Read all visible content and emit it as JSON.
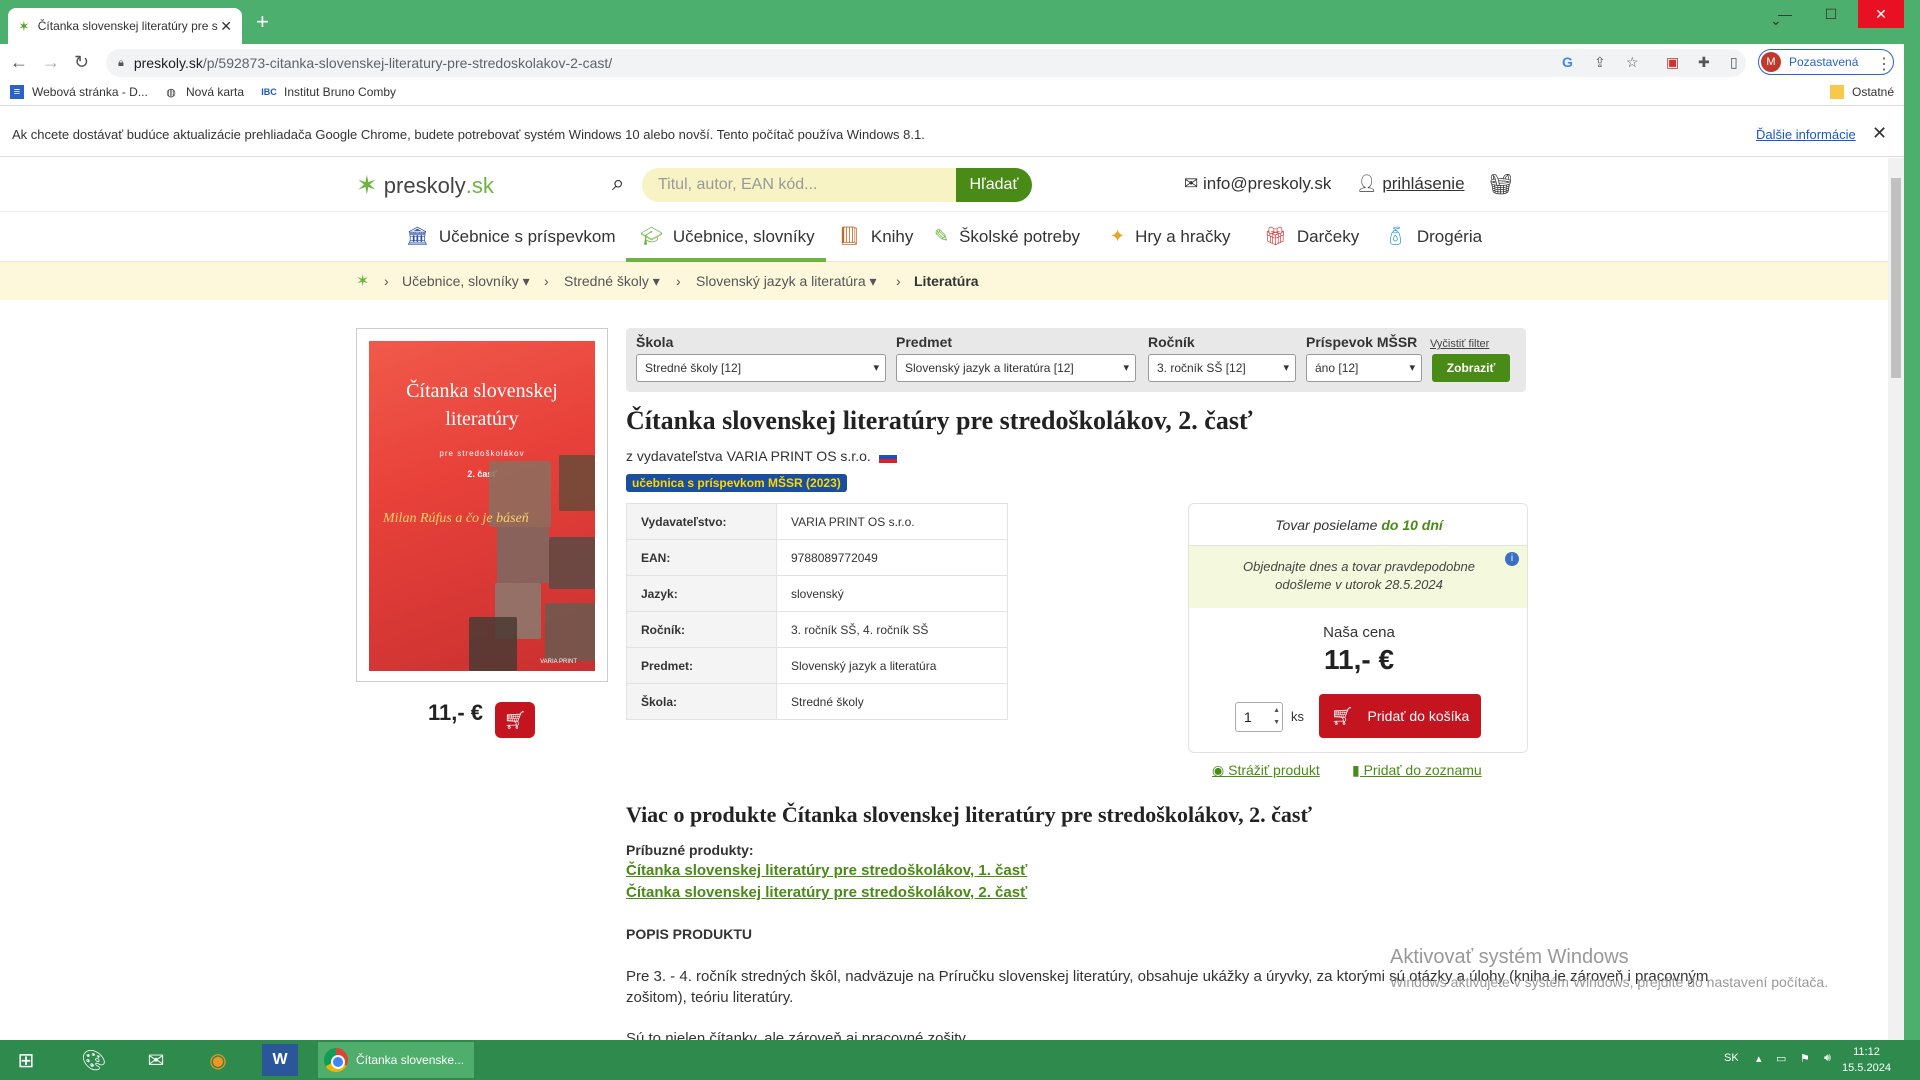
{
  "browser": {
    "tab_title": "Čítanka slovenskej literatúry pre s",
    "url_host": "preskoly.sk",
    "url_path": "/p/592873-citanka-slovenskej-literatury-pre-stredoskolakov-2-cast/",
    "profile_initial": "M",
    "profile_label": "Pozastavená",
    "bookmarks": [
      "Webová stránka - D...",
      "Nová karta",
      "Institut Bruno Comby"
    ],
    "bookmarks_other": "Ostatné",
    "infobar_text": "Ak chcete dostávať budúce aktualizácie prehliadača Google Chrome, budete potrebovať systém Windows 10 alebo novší. Tento počítač používa Windows 8.1.",
    "infobar_link": "Ďalšie informácie"
  },
  "site": {
    "logo_main": "preskoly",
    "logo_tld": ".sk",
    "search_placeholder": "Titul, autor, EAN kód...",
    "search_button": "Hľadať",
    "email": "info@preskoly.sk",
    "login": "prihlásenie",
    "nav": [
      "Učebnice s príspevkom",
      "Učebnice, slovníky",
      "Knihy",
      "Školské potreby",
      "Hry a hračky",
      "Darčeky",
      "Drogéria"
    ],
    "breadcrumbs": [
      "Učebnice, slovníky",
      "Stredné školy",
      "Slovenský jazyk a literatúra",
      "Literatúra"
    ]
  },
  "filter": {
    "labels": [
      "Škola",
      "Predmet",
      "Ročník",
      "Príspevok MŠSR"
    ],
    "values": [
      "Stredné školy [12]",
      "Slovenský jazyk a literatúra [12]",
      "3. ročník SŠ [12]",
      "áno [12]"
    ],
    "clear": "Vyčistiť filter",
    "show": "Zobraziť"
  },
  "product": {
    "title": "Čítanka slovenskej literatúry pre stredoškolákov, 2. časť",
    "publisher_line": "z vydavateľstva VARIA PRINT OS s.r.o.",
    "badge": "učebnica s príspevkom MŠSR (2023)",
    "cover": {
      "title": "Čítanka slovenskej literatúry",
      "subtitle": "pre stredoškolákov",
      "part": "2. časť",
      "signature": "Milan Rúfus a čo je báseň",
      "publisher": "VARIA PRINT"
    },
    "price_small": "11,- €",
    "details": [
      {
        "k": "Vydavateľstvo:",
        "v": "VARIA PRINT OS s.r.o."
      },
      {
        "k": "EAN:",
        "v": "9788089772049"
      },
      {
        "k": "Jazyk:",
        "v": "slovenský"
      },
      {
        "k": "Ročník:",
        "v": "3. ročník SŠ, 4. ročník SŠ"
      },
      {
        "k": "Predmet:",
        "v": "Slovenský jazyk a literatúra"
      },
      {
        "k": "Škola:",
        "v": "Stredné školy"
      }
    ],
    "shipping_pre": "Tovar posielame",
    "shipping_bold": "do 10 dní",
    "order_line1": "Objednajte dnes a tovar pravdepodobne",
    "order_line2": "odošleme v utorok 28.5.2024",
    "our_price_label": "Naša cena",
    "price": "11,- €",
    "qty": "1",
    "qty_unit": "ks",
    "add_to_cart": "Pridať do košíka",
    "watch": "Strážiť produkt",
    "add_to_list": "Pridať do zoznamu",
    "more_heading": "Viac o produkte Čítanka slovenskej literatúry pre stredoškolákov, 2. časť",
    "related_label": "Príbuzné produkty:",
    "related": [
      "Čítanka slovenskej literatúry pre stredoškolákov, 1. časť",
      "Čítanka slovenskej literatúry pre stredoškolákov, 2. časť"
    ],
    "desc_heading": "POPIS PRODUKTU",
    "desc": "Pre 3. - 4. ročník stredných škôl, nadväzuje na Príručku slovenskej literatúry, obsahuje ukážky a úryvky, za ktorými sú otázky a úlohy (kniha je zároveň i pracovným zošitom), teóriu literatúry.",
    "desc2": "Sú to nielen čítanky, ale zároveň aj pracovné zošity."
  },
  "watermark": {
    "line1": "Aktivovať systém Windows",
    "line2": "Windows aktivujete v systém Windows, prejdite do nastavení počítača."
  },
  "taskbar": {
    "chrome_label": "Čítanka slovenske...",
    "lang": "SK",
    "time": "11:12",
    "date": "15.5.2024"
  },
  "colors": {
    "accent_green": "#4a8a17",
    "cart_red": "#c4141f",
    "titlebar_green": "#4caf6e"
  }
}
